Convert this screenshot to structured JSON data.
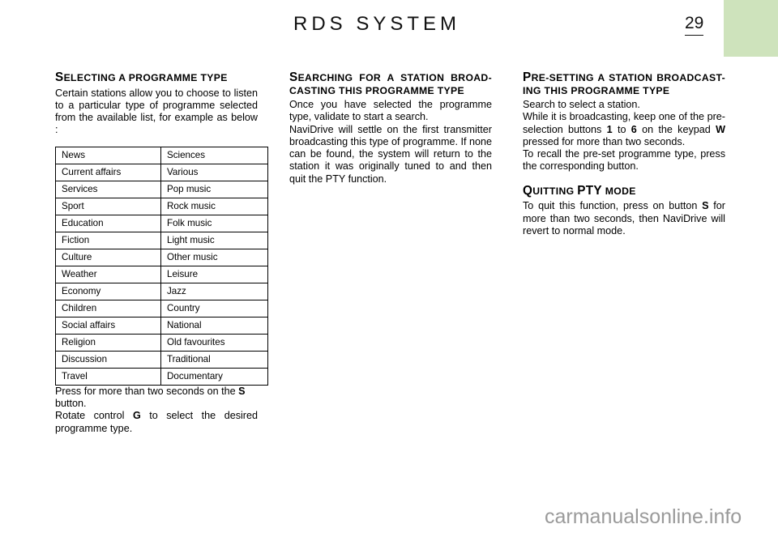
{
  "header": {
    "title": "RDS SYSTEM",
    "page_number": "29"
  },
  "decor": {
    "green_block_color": "#cee3bc"
  },
  "columns": {
    "left": {
      "heading": {
        "initial": "S",
        "rest": "electing a programme type"
      },
      "intro": "Certain stations allow you to choose to listen to a particular type of programme selected from the available list, for example as below :",
      "table": {
        "rows": [
          {
            "col1": "News",
            "col2": "Sciences"
          },
          {
            "col1": "Current affairs",
            "col2": "Various"
          },
          {
            "col1": "Services",
            "col2": "Pop music"
          },
          {
            "col1": "Sport",
            "col2": "Rock music"
          },
          {
            "col1": "Education",
            "col2": "Folk music"
          },
          {
            "col1": "Fiction",
            "col2": "Light music"
          },
          {
            "col1": "Culture",
            "col2": "Other music"
          },
          {
            "col1": "Weather",
            "col2": "Leisure"
          },
          {
            "col1": "Economy",
            "col2": "Jazz"
          },
          {
            "col1": "Children",
            "col2": "Country"
          },
          {
            "col1": "Social affairs",
            "col2": "National"
          },
          {
            "col1": "Religion",
            "col2": "Old favourites"
          },
          {
            "col1": "Discussion",
            "col2": "Traditional"
          },
          {
            "col1": "Travel",
            "col2": "Documentary"
          }
        ]
      },
      "para_press_pre": "Press for more than two seconds on the ",
      "para_press_bold": "S",
      "para_press_post": " button.",
      "para_rotate_pre": "Rotate control ",
      "para_rotate_bold": "G",
      "para_rotate_post": " to select the desired programme type."
    },
    "middle": {
      "heading": {
        "initial": "S",
        "rest": "earching for a station broad-casting this programme type"
      },
      "para1": "Once you have selected the programme type, validate to start a search.",
      "para2": "NaviDrive will settle on the first transmitter broadcasting this type of programme. If none can be found, the system will return to the station it was originally tuned to and then quit the PTY function."
    },
    "right": {
      "heading1": {
        "initial": "P",
        "rest": "re-setting a station broadcast-ing this programme type"
      },
      "para1": "Search to select a station.",
      "para2_a": "While it is broadcasting, keep one of the pre-selection buttons ",
      "para2_b1": "1",
      "para2_c": " to ",
      "para2_b2": "6",
      "para2_d": " on the keypad ",
      "para2_b3": "W",
      "para2_e": " pressed for more than two seconds.",
      "para3": "To recall the pre-set programme type, press the corresponding button.",
      "heading2": {
        "initial": "Q",
        "rest_a": "uitting ",
        "acronym": "PTY",
        "rest_b": " mode"
      },
      "para4_a": "To quit this function, press on button ",
      "para4_b": "S",
      "para4_c": " for more than two seconds, then NaviDrive will revert to normal mode."
    }
  },
  "watermark": {
    "text": "carmanualsonline.info"
  }
}
